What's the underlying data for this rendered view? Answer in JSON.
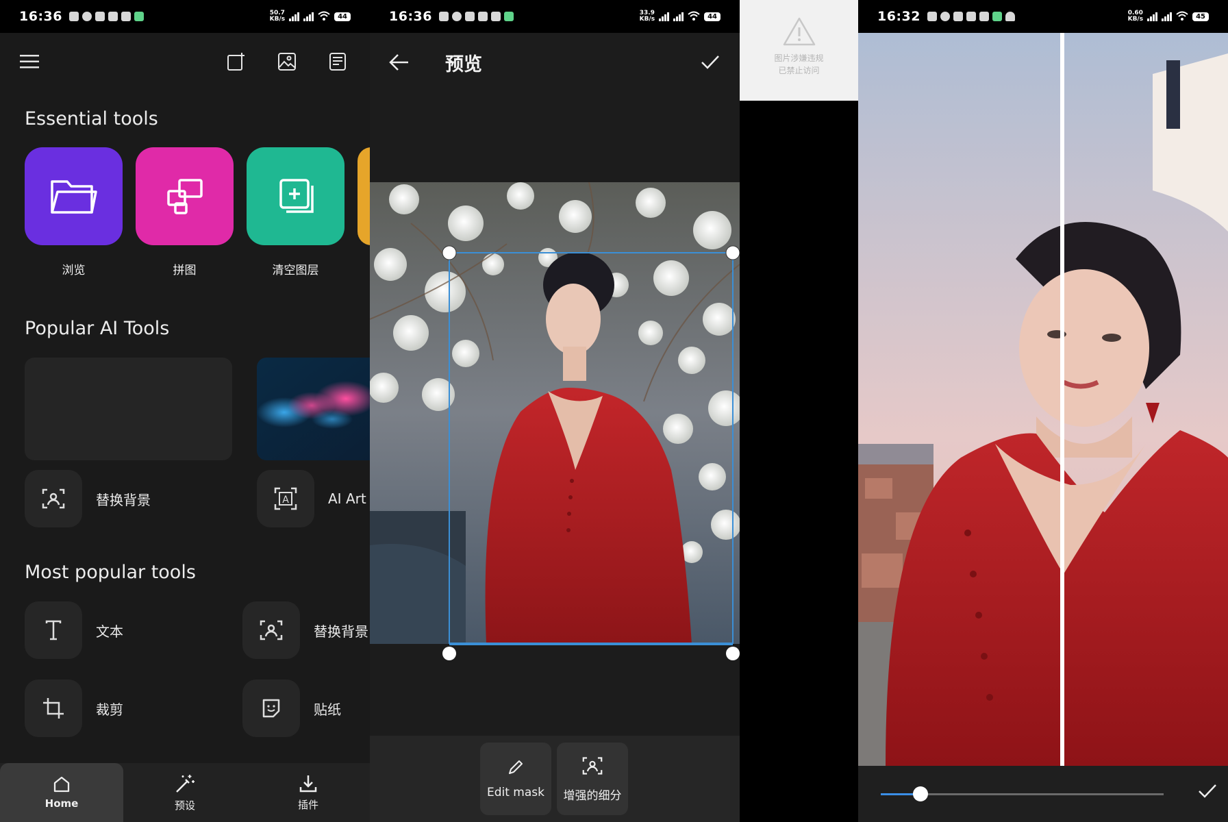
{
  "panel1": {
    "status": {
      "time": "16:36",
      "speed_value": "50.7",
      "speed_unit": "KB/s",
      "battery": "44"
    },
    "toolbar": {
      "icons": [
        "menu-icon",
        "new-canvas-icon",
        "image-icon",
        "template-icon"
      ]
    },
    "essential_title": "Essential tools",
    "essential_tiles": [
      {
        "label": "浏览",
        "color": "#6a2fe0",
        "icon": "folder-icon"
      },
      {
        "label": "拼图",
        "color": "#e02aa8",
        "icon": "collage-icon"
      },
      {
        "label": "清空图层",
        "color": "#1fb892",
        "icon": "add-layer-icon"
      }
    ],
    "popular_ai_title": "Popular AI Tools",
    "popular_ai_items": [
      {
        "label": "替换背景",
        "icon": "replace-background-icon"
      },
      {
        "label": "AI Art",
        "icon": "ai-art-icon"
      }
    ],
    "most_popular_title": "Most popular tools",
    "most_popular_items": [
      {
        "label": "文本",
        "icon": "text-icon"
      },
      {
        "label": "替换背景",
        "icon": "replace-background-icon"
      },
      {
        "label": "裁剪",
        "icon": "crop-icon"
      },
      {
        "label": "贴纸",
        "icon": "sticker-icon"
      }
    ],
    "bottom_nav": [
      {
        "label": "Home",
        "icon": "home-icon",
        "active": true
      },
      {
        "label": "预设",
        "icon": "magic-wand-icon",
        "active": false
      },
      {
        "label": "插件",
        "icon": "download-icon",
        "active": false
      }
    ]
  },
  "panel2": {
    "status": {
      "time": "16:36",
      "speed_value": "33.9",
      "speed_unit": "KB/s",
      "battery": "44"
    },
    "title": "预览",
    "buttons": [
      {
        "label": "Edit mask",
        "icon": "pencil-icon"
      },
      {
        "label": "增强的细分",
        "icon": "person-focus-icon"
      }
    ],
    "selection_color": "#3b8fd6"
  },
  "panel3": {
    "notice_line1": "图片涉嫌违规",
    "notice_line2": "已禁止访问",
    "icon": "warning-icon"
  },
  "panel4": {
    "status": {
      "time": "16:32",
      "speed_value": "0.60",
      "speed_unit": "KB/s",
      "battery": "45"
    },
    "slider_value": 0.14,
    "accent": "#3a8ee6"
  }
}
